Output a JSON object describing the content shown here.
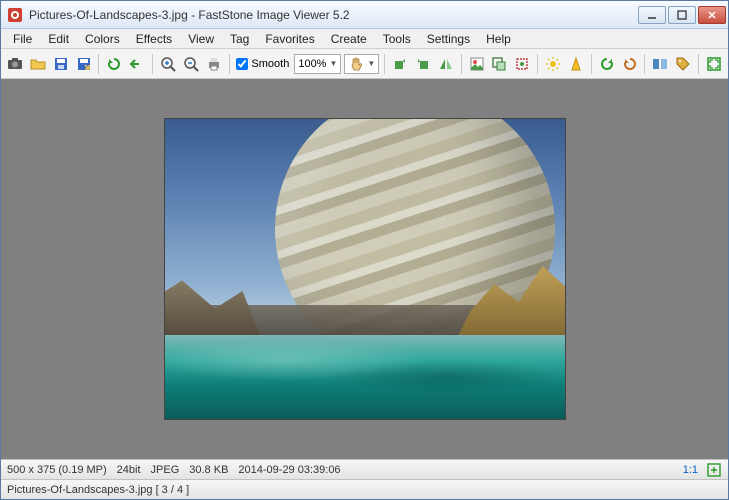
{
  "title": "Pictures-Of-Landscapes-3.jpg  -  FastStone Image Viewer 5.2",
  "menu": [
    "File",
    "Edit",
    "Colors",
    "Effects",
    "View",
    "Tag",
    "Favorites",
    "Create",
    "Tools",
    "Settings",
    "Help"
  ],
  "toolbar": {
    "smooth_label": "Smooth",
    "smooth_checked": true,
    "zoom": "100%"
  },
  "status1": {
    "dimensions": "500 x 375 (0.19 MP)",
    "depth": "24bit",
    "format": "JPEG",
    "size": "30.8 KB",
    "datetime": "2014-09-29 03:39:06",
    "ratio": "1:1"
  },
  "status2": {
    "filename_index": "Pictures-Of-Landscapes-3.jpg [ 3 / 4 ]"
  },
  "icons": {
    "camera": "camera-icon",
    "open": "open-icon",
    "save": "save-icon",
    "saveas": "saveas-icon",
    "reload": "reload-icon",
    "undo": "undo-icon",
    "zoomin": "zoomin-icon",
    "zoomout": "zoomout-icon",
    "print": "print-icon",
    "rotatel": "rotate-left-icon",
    "rotater": "rotate-right-icon",
    "flip": "flip-icon",
    "edit": "edit-icon",
    "resize": "resize-icon",
    "crop": "crop-icon",
    "light": "light-icon",
    "sharp": "sharp-icon",
    "redo2": "redo-icon",
    "undo2": "undo2-icon",
    "compare": "compare-icon",
    "tag": "tag-icon",
    "fullscreen": "fullscreen-icon"
  }
}
